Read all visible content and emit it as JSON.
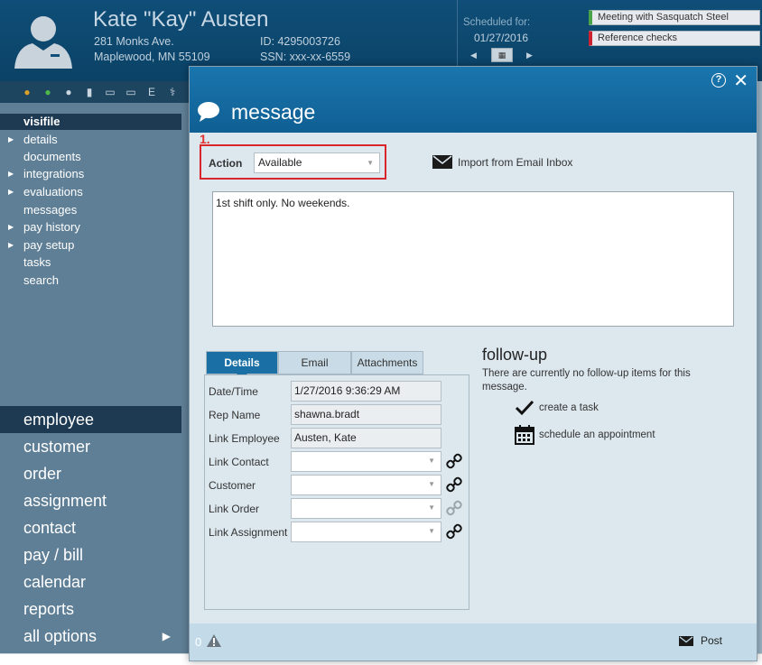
{
  "header": {
    "name": "Kate \"Kay\" Austen",
    "address_line1": "281 Monks Ave.",
    "address_line2": "Maplewood, MN 55109",
    "id_line": "ID: 4295003726",
    "ssn_line": "SSN: xxx-xx-6559",
    "scheduled_label": "Scheduled for:",
    "scheduled_date": "01/27/2016",
    "appointments": [
      {
        "label": "Meeting with Sasquatch Steel",
        "status_color": "#49a348"
      },
      {
        "label": "Reference checks",
        "status_color": "#cc2230"
      }
    ]
  },
  "sidebar": {
    "section_title": "visifile",
    "sub_items": [
      {
        "label": "details",
        "expandable": true
      },
      {
        "label": "documents",
        "expandable": false
      },
      {
        "label": "integrations",
        "expandable": true
      },
      {
        "label": "evaluations",
        "expandable": true
      },
      {
        "label": "messages",
        "expandable": false
      },
      {
        "label": "pay history",
        "expandable": true
      },
      {
        "label": "pay setup",
        "expandable": true
      },
      {
        "label": "tasks",
        "expandable": false
      },
      {
        "label": "search",
        "expandable": false
      }
    ],
    "main_nav": [
      {
        "label": "employee",
        "active": true
      },
      {
        "label": "customer"
      },
      {
        "label": "order"
      },
      {
        "label": "assignment"
      },
      {
        "label": "contact"
      },
      {
        "label": "pay / bill"
      },
      {
        "label": "calendar"
      },
      {
        "label": "reports"
      },
      {
        "label": "all options"
      }
    ]
  },
  "modal": {
    "title": "message",
    "step_marker": "1.",
    "action_label": "Action",
    "action_value": "Available",
    "import_label": "Import from Email Inbox",
    "message_text": "1st shift only. No weekends.",
    "tabs": [
      "Details",
      "Email",
      "Attachments"
    ],
    "details": {
      "date_time_label": "Date/Time",
      "date_time_value": "1/27/2016 9:36:29 AM",
      "rep_name_label": "Rep Name",
      "rep_name_value": "shawna.bradt",
      "link_employee_label": "Link Employee",
      "link_employee_value": "Austen, Kate",
      "link_contact_label": "Link Contact",
      "customer_label": "Customer",
      "link_order_label": "Link Order",
      "link_assignment_label": "Link Assignment"
    },
    "followup": {
      "title": "follow-up",
      "text": "There are currently no follow-up items for this message.",
      "create_task": "create a task",
      "schedule_appt": "schedule an appointment"
    },
    "footer": {
      "warning_count": "0",
      "post_label": "Post"
    }
  }
}
